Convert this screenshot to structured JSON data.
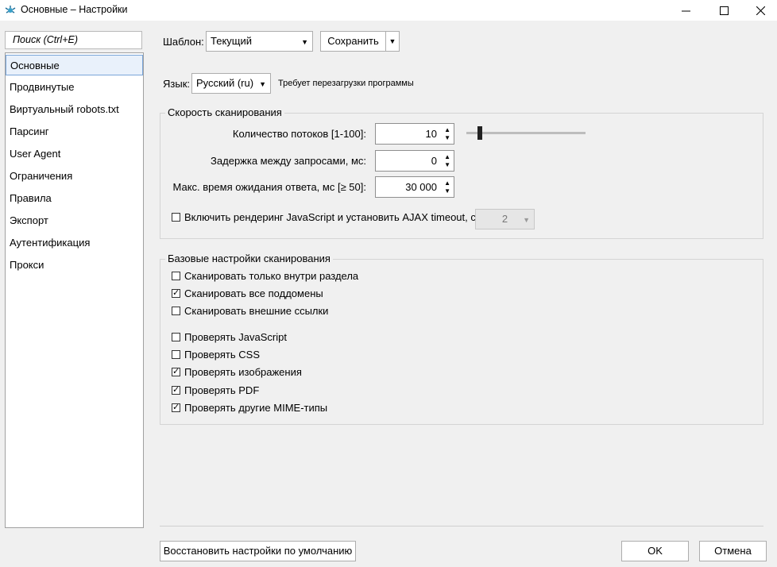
{
  "window": {
    "title": "Основные – Настройки",
    "controls": {
      "minimize": "minimize-icon",
      "maximize": "maximize-icon",
      "close": "close-icon"
    }
  },
  "sidebar": {
    "search_placeholder": "Поиск (Ctrl+E)",
    "items": [
      {
        "label": "Основные",
        "active": true
      },
      {
        "label": "Продвинутые"
      },
      {
        "label": "Виртуальный robots.txt"
      },
      {
        "label": "Парсинг"
      },
      {
        "label": "User Agent"
      },
      {
        "label": "Ограничения"
      },
      {
        "label": "Правила"
      },
      {
        "label": "Экспорт"
      },
      {
        "label": "Аутентификация"
      },
      {
        "label": "Прокси"
      }
    ]
  },
  "template": {
    "label": "Шаблон:",
    "value": "Текущий",
    "save_label": "Сохранить"
  },
  "language": {
    "label": "Язык:",
    "value": "Русский (ru)",
    "note": "Требует перезагрузки программы"
  },
  "speed": {
    "title": "Скорость сканирования",
    "threads": {
      "label": "Количество потоков [1-100]:",
      "value": "10",
      "slider_fraction": 0.1
    },
    "delay": {
      "label": "Задержка между запросами, мс:",
      "value": "0"
    },
    "timeout": {
      "label": "Макс. время ожидания ответа, мс [≥ 50]:",
      "value": "30 000"
    },
    "js_render": {
      "label": "Включить рендеринг JavaScript и установить AJAX timeout, с:",
      "checked": false,
      "timeout_value": "2"
    }
  },
  "basic": {
    "title": "Базовые настройки сканирования",
    "options": [
      {
        "label": "Сканировать только внутри раздела",
        "checked": false
      },
      {
        "label": "Сканировать все поддомены",
        "checked": true
      },
      {
        "label": "Сканировать внешние ссылки",
        "checked": false
      },
      {
        "label": "Проверять JavaScript",
        "checked": false
      },
      {
        "label": "Проверять CSS",
        "checked": false
      },
      {
        "label": "Проверять изображения",
        "checked": true
      },
      {
        "label": "Проверять PDF",
        "checked": true
      },
      {
        "label": "Проверять другие MIME-типы",
        "checked": true
      }
    ]
  },
  "footer": {
    "restore_label": "Восстановить настройки по умолчанию",
    "ok_label": "OK",
    "cancel_label": "Отмена"
  },
  "colors": {
    "accent": "#7aa6d9",
    "selection_bg": "#e9f1fb",
    "window_bg": "#f0f0f0"
  }
}
